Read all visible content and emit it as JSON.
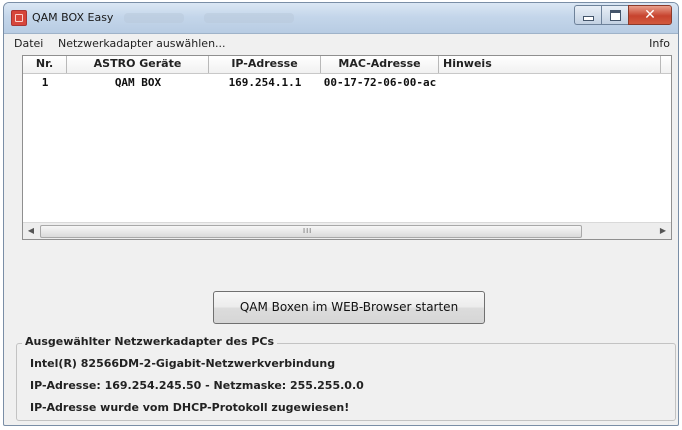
{
  "window": {
    "title": "QAM BOX Easy"
  },
  "menu": {
    "items": [
      "Datei",
      "Netzwerkadapter auswählen...",
      "Info"
    ]
  },
  "table": {
    "columns": [
      "Nr.",
      "ASTRO Geräte",
      "IP-Adresse",
      "MAC-Adresse",
      "Hinweis"
    ],
    "rows": [
      [
        "1",
        "QAM BOX",
        "169.254.1.1",
        "00-17-72-06-00-ac",
        ""
      ]
    ]
  },
  "start_button": {
    "label": "QAM Boxen im WEB-Browser starten"
  },
  "adapter_group": {
    "legend": "Ausgewählter Netzwerkadapter des PCs",
    "adapter_name": "Intel(R) 82566DM-2-Gigabit-Netzwerkverbindung",
    "address_line": "IP-Adresse: 169.254.245.50  -  Netzmaske: 255.255.0.0",
    "dhcp_line": "IP-Adresse wurde vom DHCP-Protokoll zugewiesen!"
  },
  "icons": {
    "app": "app-icon",
    "minimize": "minimize-icon",
    "maximize": "maximize-icon",
    "close": "close-icon",
    "scroll_left": "scroll-left-arrow-icon",
    "scroll_right": "scroll-right-arrow-icon"
  }
}
